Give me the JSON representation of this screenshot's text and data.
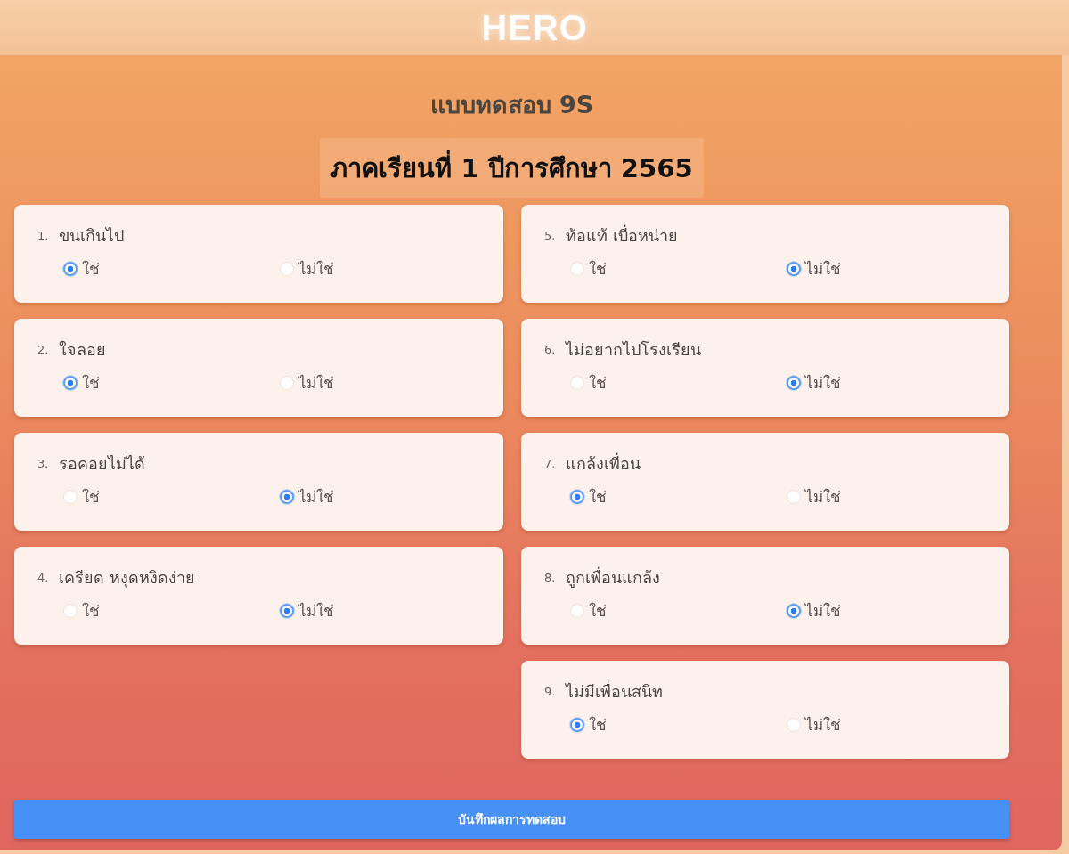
{
  "header": {
    "logo": "HERO"
  },
  "title": "แบบทดสอบ 9S",
  "subtitle": "ภาคเรียนที่ 1 ปีการศึกษา 2565",
  "columns": [
    {
      "questions": [
        {
          "number": "1.",
          "text": "ขนเกินไป",
          "options": [
            {
              "label": "ใช่",
              "selected": true
            },
            {
              "label": "ไม่ใช่",
              "selected": false
            }
          ]
        },
        {
          "number": "2.",
          "text": "ใจลอย",
          "options": [
            {
              "label": "ใช่",
              "selected": true
            },
            {
              "label": "ไม่ใช่",
              "selected": false
            }
          ]
        },
        {
          "number": "3.",
          "text": "รอคอยไม่ได้",
          "options": [
            {
              "label": "ใช่",
              "selected": false
            },
            {
              "label": "ไม่ใช่",
              "selected": true
            }
          ]
        },
        {
          "number": "4.",
          "text": "เครียด หงุดหงิดง่าย",
          "options": [
            {
              "label": "ใช่",
              "selected": false
            },
            {
              "label": "ไม่ใช่",
              "selected": true
            }
          ]
        }
      ]
    },
    {
      "questions": [
        {
          "number": "5.",
          "text": "ท้อแท้ เบื่อหน่าย",
          "options": [
            {
              "label": "ใช่",
              "selected": false
            },
            {
              "label": "ไม่ใช่",
              "selected": true
            }
          ]
        },
        {
          "number": "6.",
          "text": "ไม่อยากไปโรงเรียน",
          "options": [
            {
              "label": "ใช่",
              "selected": false
            },
            {
              "label": "ไม่ใช่",
              "selected": true
            }
          ]
        },
        {
          "number": "7.",
          "text": "แกล้งเพื่อน",
          "options": [
            {
              "label": "ใช่",
              "selected": true
            },
            {
              "label": "ไม่ใช่",
              "selected": false
            }
          ]
        },
        {
          "number": "8.",
          "text": "ถูกเพื่อนแกล้ง",
          "options": [
            {
              "label": "ใช่",
              "selected": false
            },
            {
              "label": "ไม่ใช่",
              "selected": true
            }
          ]
        },
        {
          "number": "9.",
          "text": "ไม่มีเพื่อนสนิท",
          "options": [
            {
              "label": "ใช่",
              "selected": true
            },
            {
              "label": "ไม่ใช่",
              "selected": false
            }
          ]
        }
      ]
    }
  ],
  "submit_button": "บันทึกผลการทดสอบ"
}
